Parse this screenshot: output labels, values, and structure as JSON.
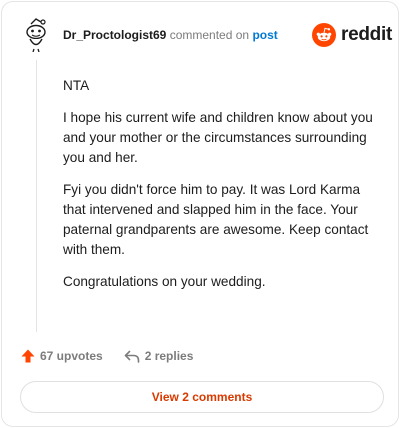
{
  "comment": {
    "username": "Dr_Proctologist69",
    "action": "commented on",
    "target": "post",
    "paragraphs": [
      "NTA",
      "I hope his current wife and children know about you and your mother or the circumstances surrounding you and her.",
      "Fyi you didn't force him to pay. It was Lord Karma that intervened and slapped him in the face. Your paternal grandparents are awesome. Keep contact with them.",
      "Congratulations on your wedding."
    ]
  },
  "brand": {
    "name": "reddit",
    "logo_icon": "reddit-snoo-icon",
    "accent": "#ff4500"
  },
  "stats": {
    "upvotes": "67 upvotes",
    "replies": "2 replies",
    "upvote_icon": "upvote-arrow-icon",
    "reply_icon": "reply-arrow-icon",
    "upvote_color": "#ff4500"
  },
  "footer": {
    "view_comments": "View 2 comments",
    "button_text_color": "#d93a00"
  }
}
